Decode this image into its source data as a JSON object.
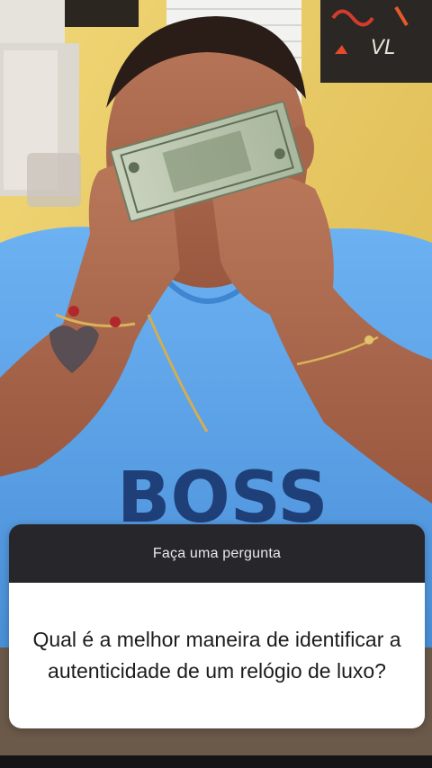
{
  "question_sticker": {
    "header": "Faça uma pergunta",
    "question": "Qual é a melhor maneira de identificar a autenticidade de um relógio de luxo?"
  },
  "shirt_logo": "BOSS",
  "artwork_initials": "VL",
  "colors": {
    "wall": "#e8c75a",
    "shirt": "#5aa0e6",
    "card_header_bg": "#26262b",
    "card_body_bg": "#ffffff"
  }
}
